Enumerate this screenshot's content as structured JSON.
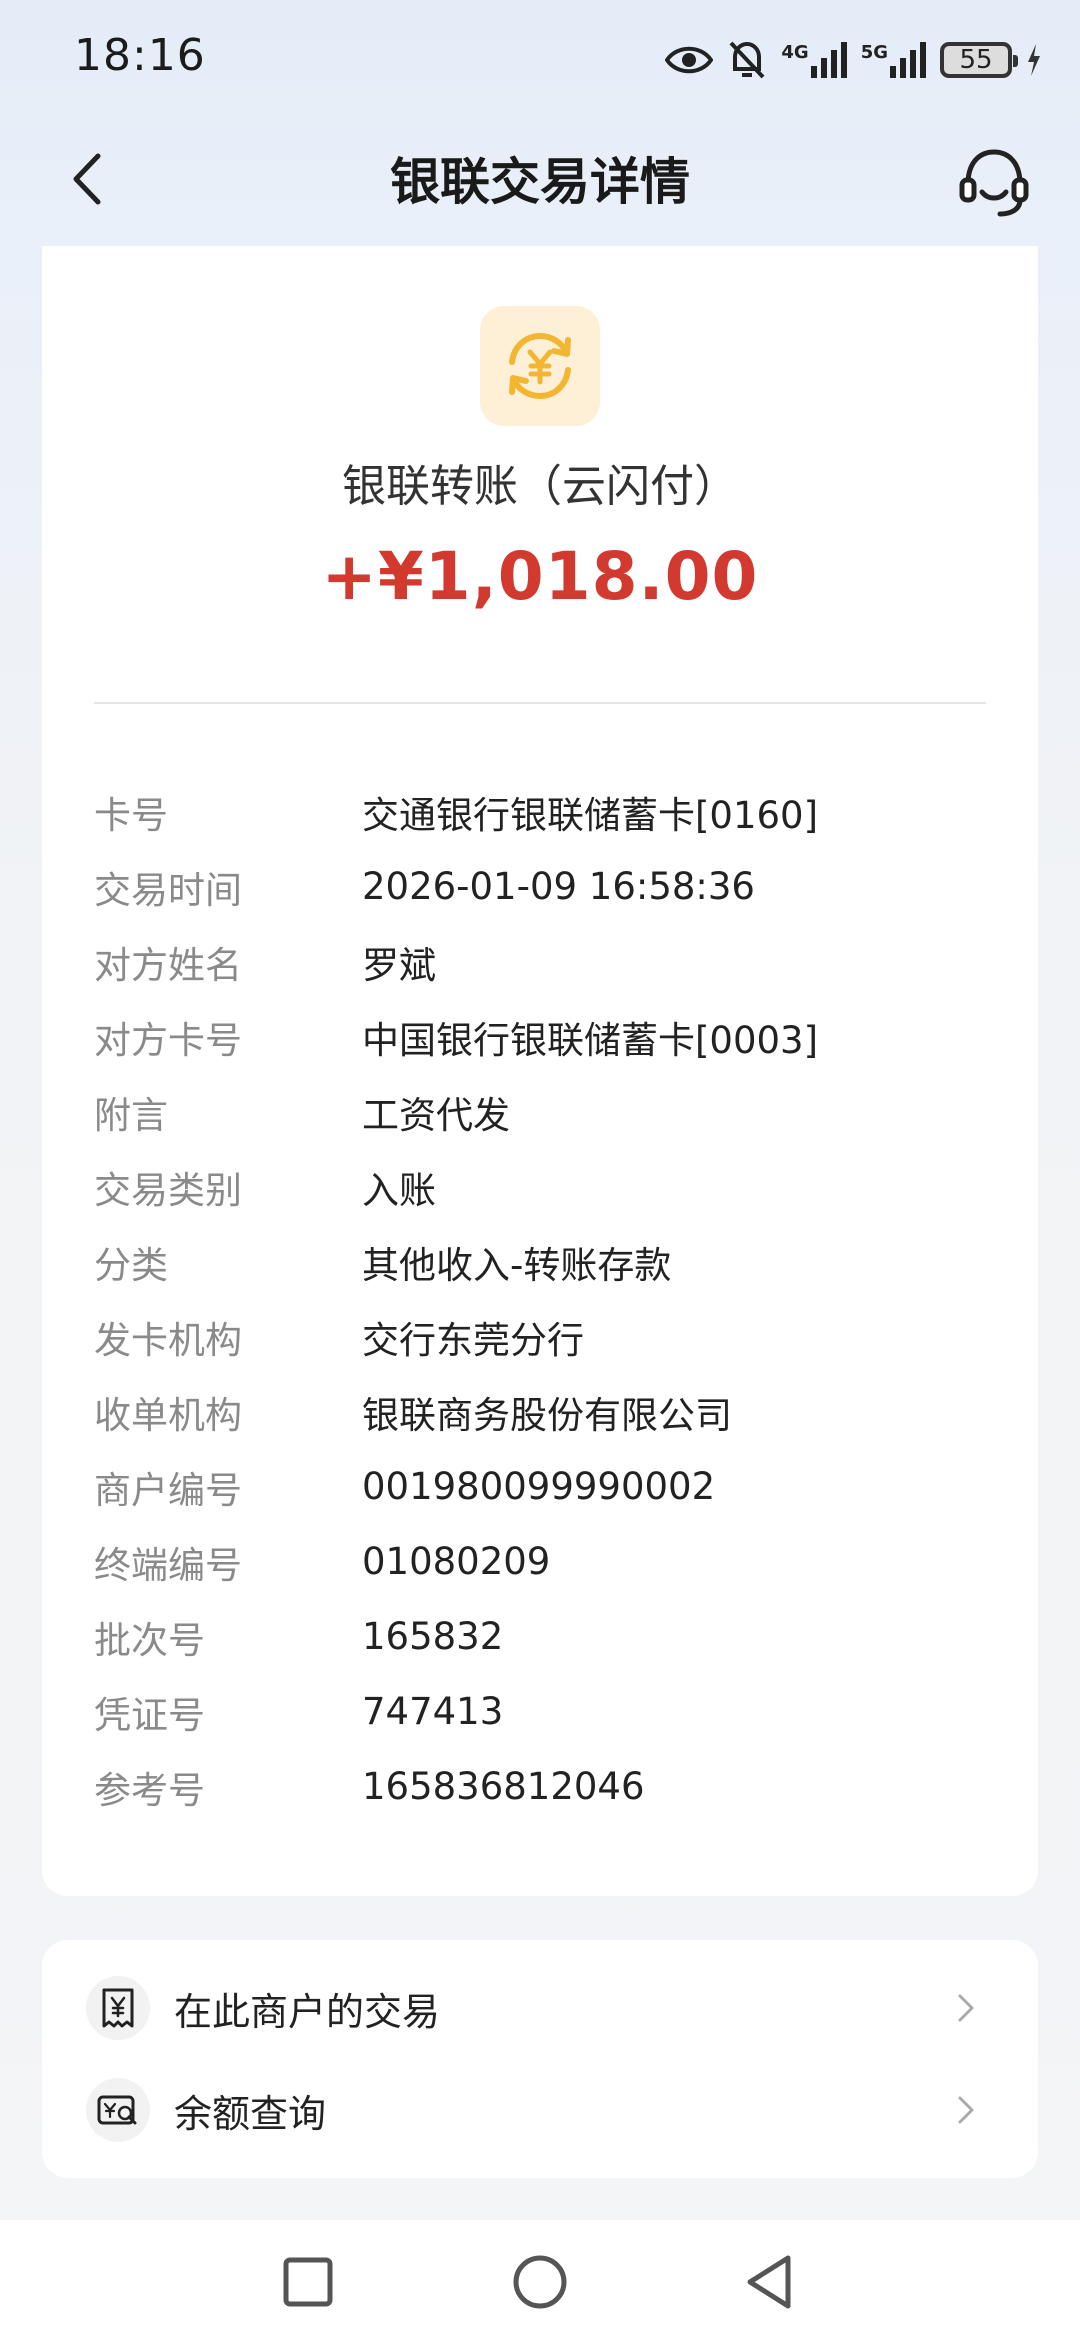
{
  "status_bar": {
    "time": "18:16",
    "network_1": "4G",
    "network_2": "5G",
    "battery": "55"
  },
  "header": {
    "title": "银联交易详情"
  },
  "transaction": {
    "type": "银联转账（云闪付）",
    "amount": "+¥1,018.00",
    "icon": "yuan-exchange-icon",
    "amount_color": "#d23a30",
    "icon_bg": "#fdf0d6",
    "icon_color": "#f2b632"
  },
  "details": [
    {
      "label": "卡号",
      "value": "交通银行银联储蓄卡[0160]"
    },
    {
      "label": "交易时间",
      "value": "2026-01-09 16:58:36"
    },
    {
      "label": "对方姓名",
      "value": "罗斌"
    },
    {
      "label": "对方卡号",
      "value": "中国银行银联储蓄卡[0003]"
    },
    {
      "label": "附言",
      "value": "工资代发"
    },
    {
      "label": "交易类别",
      "value": "入账"
    },
    {
      "label": "分类",
      "value": "其他收入-转账存款"
    },
    {
      "label": "发卡机构",
      "value": "交行东莞分行"
    },
    {
      "label": "收单机构",
      "value": "银联商务股份有限公司"
    },
    {
      "label": "商户编号",
      "value": "001980099990002"
    },
    {
      "label": "终端编号",
      "value": "01080209"
    },
    {
      "label": "批次号",
      "value": "165832"
    },
    {
      "label": "凭证号",
      "value": "747413"
    },
    {
      "label": "参考号",
      "value": "165836812046"
    }
  ],
  "actions": [
    {
      "label": "在此商户的交易",
      "icon": "receipt-yuan-icon"
    },
    {
      "label": "余额查询",
      "icon": "balance-search-icon"
    }
  ]
}
